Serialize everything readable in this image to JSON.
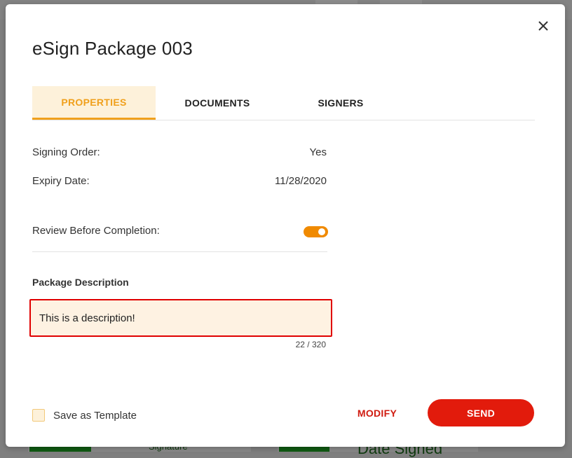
{
  "modal": {
    "title": "eSign Package 003",
    "tabs": [
      {
        "label": "PROPERTIES",
        "active": true
      },
      {
        "label": "DOCUMENTS",
        "active": false
      },
      {
        "label": "SIGNERS",
        "active": false
      }
    ],
    "properties": {
      "signing_order": {
        "label": "Signing Order:",
        "value": "Yes"
      },
      "expiry_date": {
        "label": "Expiry Date:",
        "value": "11/28/2020"
      },
      "review_before_completion": {
        "label": "Review Before Completion:",
        "enabled": true
      }
    },
    "description": {
      "label": "Package Description",
      "value": "This is a description!",
      "char_count": "22 / 320"
    },
    "footer": {
      "save_template_label": "Save as Template",
      "modify_label": "MODIFY",
      "send_label": "SEND"
    }
  },
  "background": {
    "signature_label": "Signature",
    "date_signed_label": "Date Signed"
  },
  "colors": {
    "accent": "#f0a01c",
    "toggle": "#f08a00",
    "send": "#e21b0c",
    "error_border": "#e00000"
  }
}
